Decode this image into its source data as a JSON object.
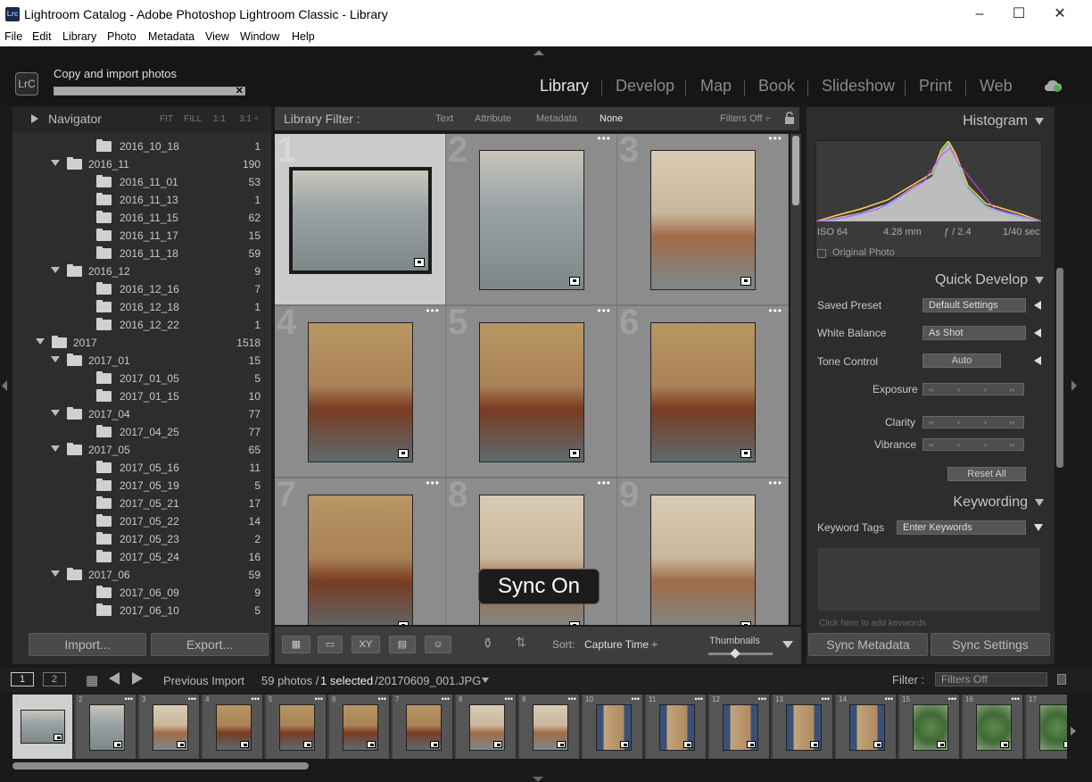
{
  "window": {
    "title": "Lightroom Catalog - Adobe Photoshop Lightroom Classic - Library",
    "app_icon": "Lrc",
    "controls": [
      "–",
      "☐",
      "✕"
    ]
  },
  "menu": [
    "File",
    "Edit",
    "Library",
    "Photo",
    "Metadata",
    "View",
    "Window",
    "Help"
  ],
  "identity": {
    "badge": "LrC",
    "status": "Copy and import photos",
    "progress": 1.0
  },
  "modules": [
    "Library",
    "Develop",
    "Map",
    "Book",
    "Slideshow",
    "Print",
    "Web"
  ],
  "active_module": "Library",
  "navigator": {
    "label": "Navigator",
    "options": [
      "FIT",
      "FILL",
      "1:1",
      "3:1 ÷"
    ]
  },
  "folders": [
    {
      "name": "2016_10_18",
      "count": "1",
      "level": 2
    },
    {
      "name": "2016_11",
      "count": "190",
      "level": 1
    },
    {
      "name": "2016_11_01",
      "count": "53",
      "level": 2
    },
    {
      "name": "2016_11_13",
      "count": "1",
      "level": 2
    },
    {
      "name": "2016_11_15",
      "count": "62",
      "level": 2
    },
    {
      "name": "2016_11_17",
      "count": "15",
      "level": 2
    },
    {
      "name": "2016_11_18",
      "count": "59",
      "level": 2
    },
    {
      "name": "2016_12",
      "count": "9",
      "level": 1
    },
    {
      "name": "2016_12_16",
      "count": "7",
      "level": 2
    },
    {
      "name": "2016_12_18",
      "count": "1",
      "level": 2
    },
    {
      "name": "2016_12_22",
      "count": "1",
      "level": 2
    },
    {
      "name": "2017",
      "count": "1518",
      "level": 0
    },
    {
      "name": "2017_01",
      "count": "15",
      "level": 1
    },
    {
      "name": "2017_01_05",
      "count": "5",
      "level": 2
    },
    {
      "name": "2017_01_15",
      "count": "10",
      "level": 2
    },
    {
      "name": "2017_04",
      "count": "77",
      "level": 1
    },
    {
      "name": "2017_04_25",
      "count": "77",
      "level": 2
    },
    {
      "name": "2017_05",
      "count": "65",
      "level": 1
    },
    {
      "name": "2017_05_16",
      "count": "11",
      "level": 2
    },
    {
      "name": "2017_05_19",
      "count": "5",
      "level": 2
    },
    {
      "name": "2017_05_21",
      "count": "17",
      "level": 2
    },
    {
      "name": "2017_05_22",
      "count": "14",
      "level": 2
    },
    {
      "name": "2017_05_23",
      "count": "2",
      "level": 2
    },
    {
      "name": "2017_05_24",
      "count": "16",
      "level": 2
    },
    {
      "name": "2017_06",
      "count": "59",
      "level": 1
    },
    {
      "name": "2017_06_09",
      "count": "9",
      "level": 2
    },
    {
      "name": "2017_06_10",
      "count": "5",
      "level": 2
    }
  ],
  "left_buttons": {
    "import": "Import...",
    "export": "Export..."
  },
  "library_filter": {
    "label": "Library Filter :",
    "options": [
      "Text",
      "Attribute",
      "Metadata",
      "None"
    ],
    "selected": "None",
    "preset": "Filters Off ÷"
  },
  "grid": {
    "cells": [
      {
        "num": "1",
        "orientation": "landscape",
        "scene": "spider",
        "selected": true
      },
      {
        "num": "2",
        "orientation": "portrait",
        "scene": "spider"
      },
      {
        "num": "3",
        "orientation": "portrait",
        "scene": "room"
      },
      {
        "num": "4",
        "orientation": "portrait",
        "scene": "room-dark"
      },
      {
        "num": "5",
        "orientation": "portrait",
        "scene": "room-dark"
      },
      {
        "num": "6",
        "orientation": "portrait",
        "scene": "room-dark"
      },
      {
        "num": "7",
        "orientation": "portrait",
        "scene": "room-dark"
      },
      {
        "num": "8",
        "orientation": "portrait",
        "scene": "room"
      },
      {
        "num": "9",
        "orientation": "portrait",
        "scene": "room"
      }
    ]
  },
  "toast": "Sync On",
  "toolbar": {
    "sort_label": "Sort:",
    "sort_value": "Capture Time ÷",
    "thumbnails_label": "Thumbnails",
    "compare_label": "XY"
  },
  "histogram": {
    "label": "Histogram",
    "iso": "ISO 64",
    "focal": "4.28 mm",
    "aperture": "ƒ / 2.4",
    "shutter": "1/40 sec",
    "original": "Original Photo"
  },
  "quick_develop": {
    "label": "Quick Develop",
    "saved_preset_label": "Saved Preset",
    "saved_preset_value": "Default Settings",
    "white_balance_label": "White Balance",
    "white_balance_value": "As Shot",
    "tone_control_label": "Tone Control",
    "auto_label": "Auto",
    "exposure_label": "Exposure",
    "clarity_label": "Clarity",
    "vibrance_label": "Vibrance",
    "reset_label": "Reset All"
  },
  "keywording": {
    "label": "Keywording",
    "tags_label": "Keyword Tags",
    "tags_value": "Enter Keywords",
    "hint": "Click here to add keywords"
  },
  "right_buttons": {
    "sync_metadata": "Sync Metadata",
    "sync_settings": "Sync Settings"
  },
  "filmstrip_bar": {
    "view1": "1",
    "view2": "2",
    "source": "Previous Import",
    "count": "59 photos /",
    "selected": "1 selected",
    "filename": "/20170609_001.JPG",
    "filter_label": "Filter :",
    "filter_value": "Filters Off"
  },
  "filmstrip": [
    {
      "num": "1",
      "scene": "spider",
      "selected": true
    },
    {
      "num": "2",
      "scene": "spider"
    },
    {
      "num": "3",
      "scene": "room"
    },
    {
      "num": "4",
      "scene": "room-dark"
    },
    {
      "num": "5",
      "scene": "room-dark"
    },
    {
      "num": "6",
      "scene": "room-dark"
    },
    {
      "num": "7",
      "scene": "room-dark"
    },
    {
      "num": "8",
      "scene": "room"
    },
    {
      "num": "9",
      "scene": "room"
    },
    {
      "num": "10",
      "scene": "door"
    },
    {
      "num": "11",
      "scene": "door"
    },
    {
      "num": "12",
      "scene": "door"
    },
    {
      "num": "13",
      "scene": "door"
    },
    {
      "num": "14",
      "scene": "door"
    },
    {
      "num": "15",
      "scene": "plant"
    },
    {
      "num": "16",
      "scene": "plant"
    },
    {
      "num": "17",
      "scene": "plant"
    }
  ],
  "colors": {
    "panel": "#2d2d2d",
    "grid_bg": "#777777",
    "cell": "#8c8c8c",
    "cell_selected": "#cbcbcb",
    "active_module": "#e8e8e8"
  }
}
